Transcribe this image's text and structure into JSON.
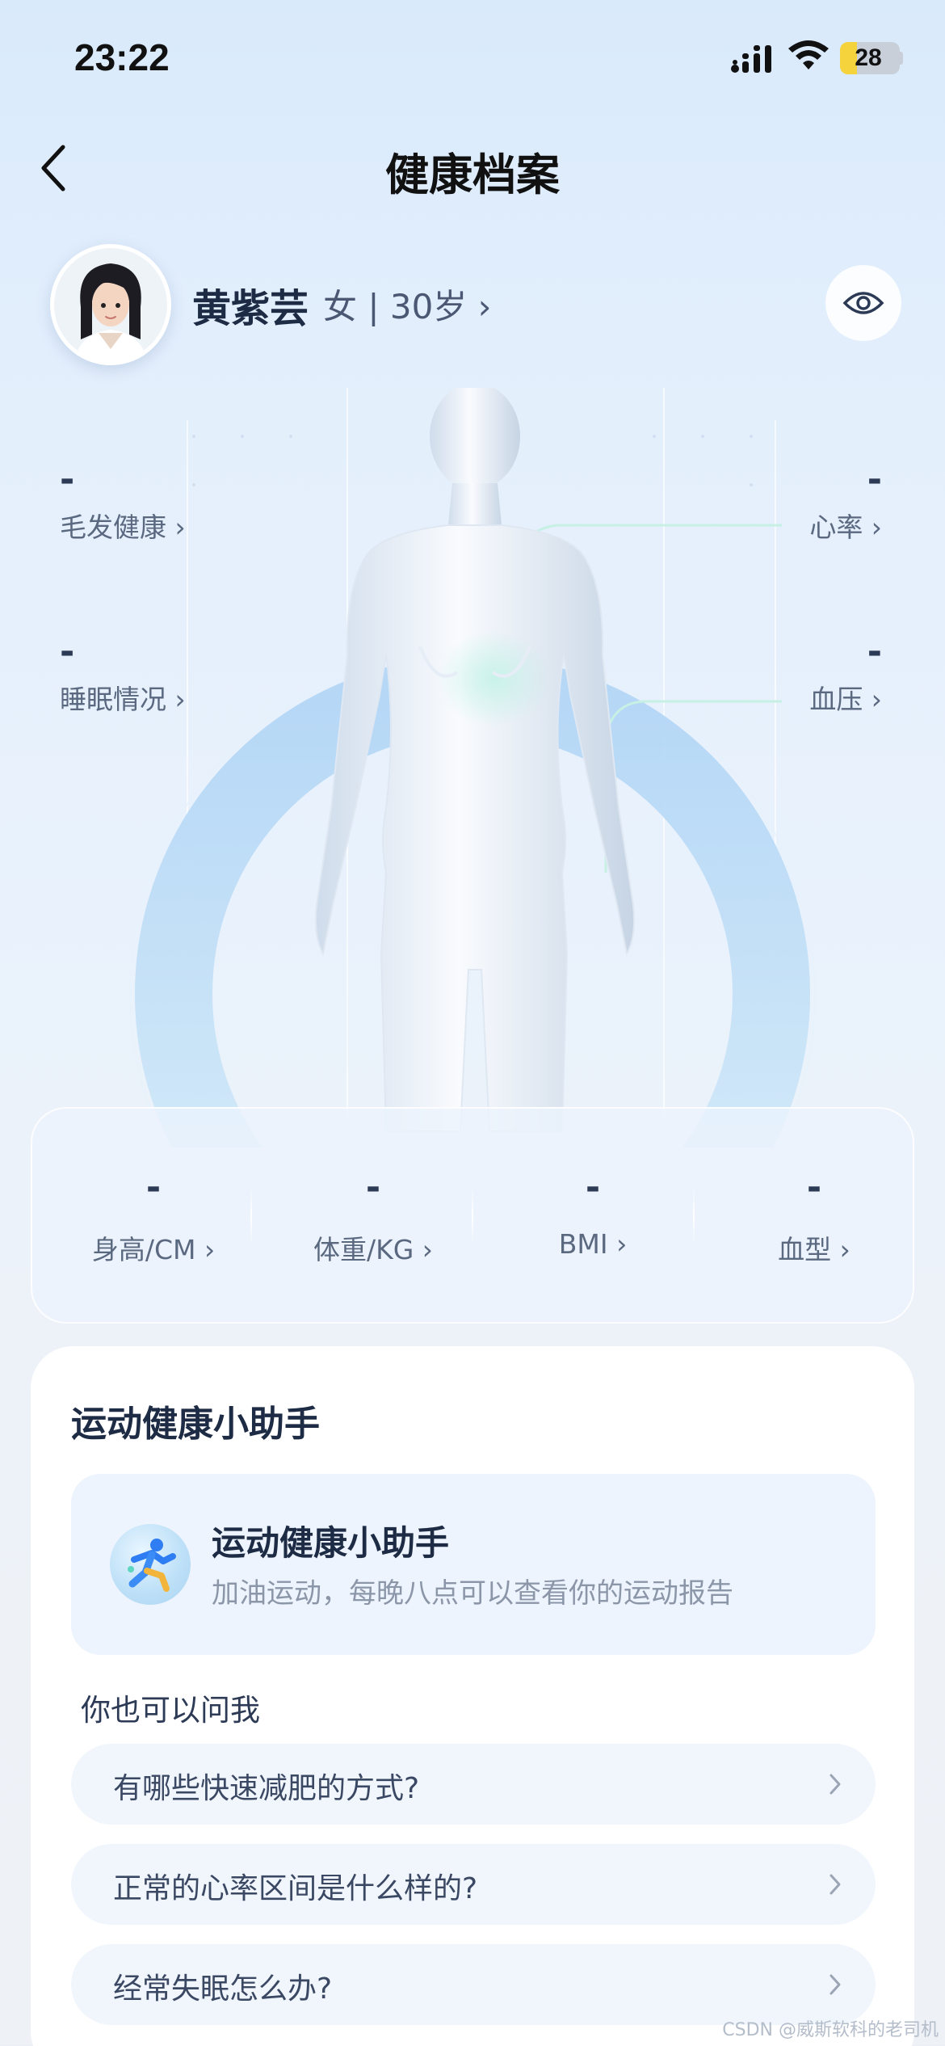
{
  "status_bar": {
    "time": "23:22",
    "battery": "28",
    "battery_level": 0.28
  },
  "header": {
    "title": "健康档案"
  },
  "profile": {
    "name": "黄紫芸",
    "meta": "女 | 30岁 ›"
  },
  "body_metrics": [
    {
      "value": "-",
      "label": "毛发健康 ›"
    },
    {
      "value": "-",
      "label": "睡眠情况 ›"
    },
    {
      "value": "-",
      "label": "心率 ›"
    },
    {
      "value": "-",
      "label": "血压 ›"
    }
  ],
  "stats": [
    {
      "value": "-",
      "label": "身高/CM ›"
    },
    {
      "value": "-",
      "label": "体重/KG ›"
    },
    {
      "value": "-",
      "label": "BMI ›"
    },
    {
      "value": "-",
      "label": "血型 ›"
    }
  ],
  "assistant": {
    "section_title": "运动健康小助手",
    "intro_title": "运动健康小助手",
    "intro_desc": "加油运动，每晚八点可以查看你的运动报告",
    "ask_label": "你也可以问我",
    "questions": [
      "有哪些快速减肥的方式?",
      "正常的心率区间是什么样的?",
      "经常失眠怎么办?"
    ]
  },
  "watermark": "CSDN @威斯软科的老司机",
  "colors": {
    "accent": "#2c3a55",
    "card_bg": "#eef4fd",
    "battery": "#f5d33c"
  }
}
